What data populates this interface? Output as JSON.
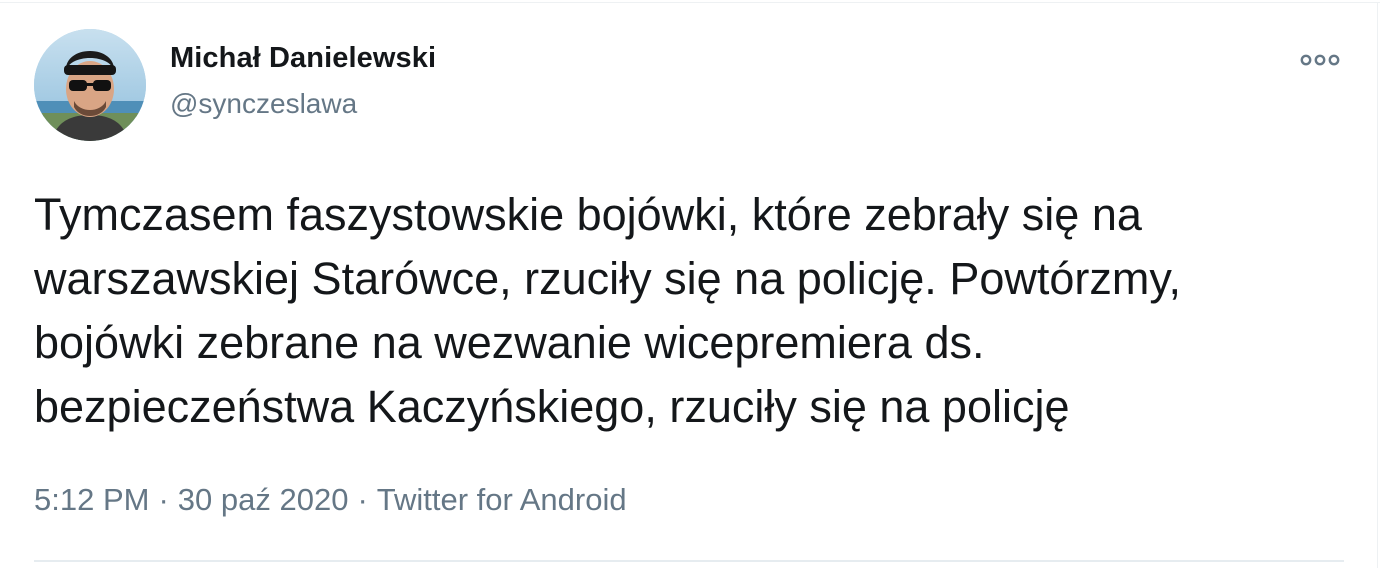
{
  "tweet": {
    "author": {
      "display_name": "Michał Danielewski",
      "handle": "@synczeslawa"
    },
    "text": "Tymczasem faszystowskie bojówki, które zebrały się na\nwarszawskiej Starówce, rzuciły się na policję. Powtórzmy,\nbojówki zebrane na wezwanie wicepremiera ds.\nbezpieczeństwa Kaczyńskiego, rzuciły się na policję",
    "time": "5:12 PM",
    "separator": "·",
    "date": "30 paź 2020",
    "source": "Twitter for Android"
  },
  "icons": {
    "more": "more-options-icon",
    "avatar": "avatar"
  },
  "colors": {
    "text_primary": "#14171a",
    "text_secondary": "#657786",
    "divider": "#e6ecf0",
    "background": "#ffffff"
  }
}
